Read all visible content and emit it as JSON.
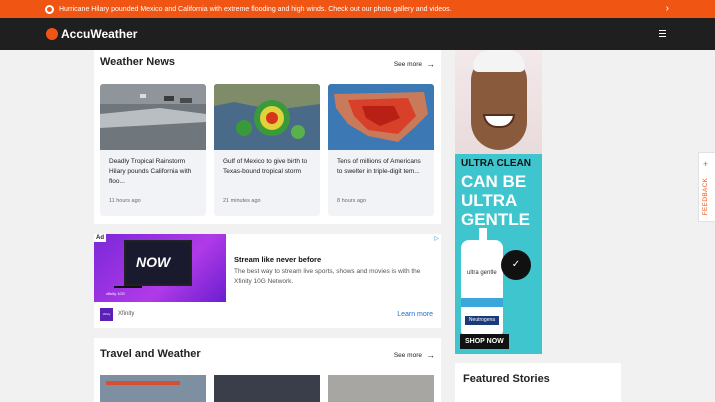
{
  "alert": {
    "text": "Hurricane Hilary pounded Mexico and California with extreme flooding and high winds. Check out our photo gallery and videos.",
    "chevron": "›"
  },
  "header": {
    "logo": "AccuWeather"
  },
  "weather_news": {
    "title": "Weather News",
    "see_more": "See more",
    "stories": [
      {
        "title": "Deadly Tropical Rainstorm Hilary pounds California with floo...",
        "time": "11 hours ago"
      },
      {
        "title": "Gulf of Mexico to give birth to Texas-bound tropical storm",
        "time": "21 minutes ago"
      },
      {
        "title": "Tens of millions of Americans to swelter in triple-digit tem...",
        "time": "8 hours ago"
      }
    ]
  },
  "ad": {
    "badge": "Ad",
    "banner_word": "NOW",
    "banner_fine": "xfinity 10G",
    "headline": "Stream like never before",
    "description": "The best way to stream live sports, shows and movies is with the Xfinity 10G Network.",
    "brand": "Xfinity",
    "cta": "Learn more",
    "logo_text": "xfinity"
  },
  "travel": {
    "title": "Travel and Weather",
    "see_more": "See more"
  },
  "side_ad": {
    "line1": "ULTRA CLEAN",
    "line2": "CAN BE",
    "line3": "ULTRA",
    "line4": "GENTLE",
    "product": "ultra gentle",
    "product_brand": "Neutrogena",
    "cta": "SHOP NOW"
  },
  "featured": {
    "title": "Featured Stories"
  },
  "feedback": {
    "label": "FEEDBACK",
    "plus": "+"
  },
  "colors": {
    "accent": "#f05514",
    "header_bg": "#1f1f1f",
    "link": "#1a6fd4"
  },
  "icons": [
    "alert-icon",
    "accuweather-logo-icon",
    "menu-icon",
    "arrow-right-icon",
    "adchoices-icon",
    "plus-icon"
  ]
}
